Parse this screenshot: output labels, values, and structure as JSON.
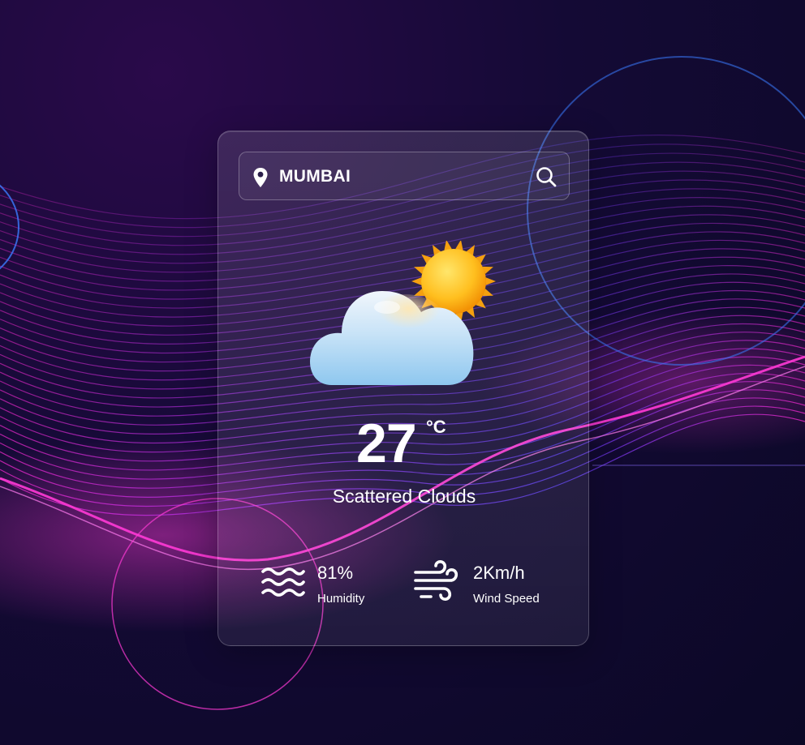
{
  "search": {
    "city": "MUMBAI"
  },
  "weather": {
    "temperature": "27",
    "unit": "°C",
    "condition": "Scattered Clouds",
    "icon": "sun-behind-cloud-icon"
  },
  "stats": {
    "humidity": {
      "value": "81%",
      "label": "Humidity",
      "icon": "water-waves-icon"
    },
    "wind": {
      "value": "2Km/h",
      "label": "Wind Speed",
      "icon": "wind-icon"
    }
  },
  "colors": {
    "background": "#140a35",
    "wave_pink": "#ff2bd6",
    "wave_violet": "#7a2cff",
    "wave_blue": "#3a4bff",
    "accent_line": "#3b7cff",
    "sun": "#ffb21a",
    "cloud": "#a9d6f7"
  }
}
